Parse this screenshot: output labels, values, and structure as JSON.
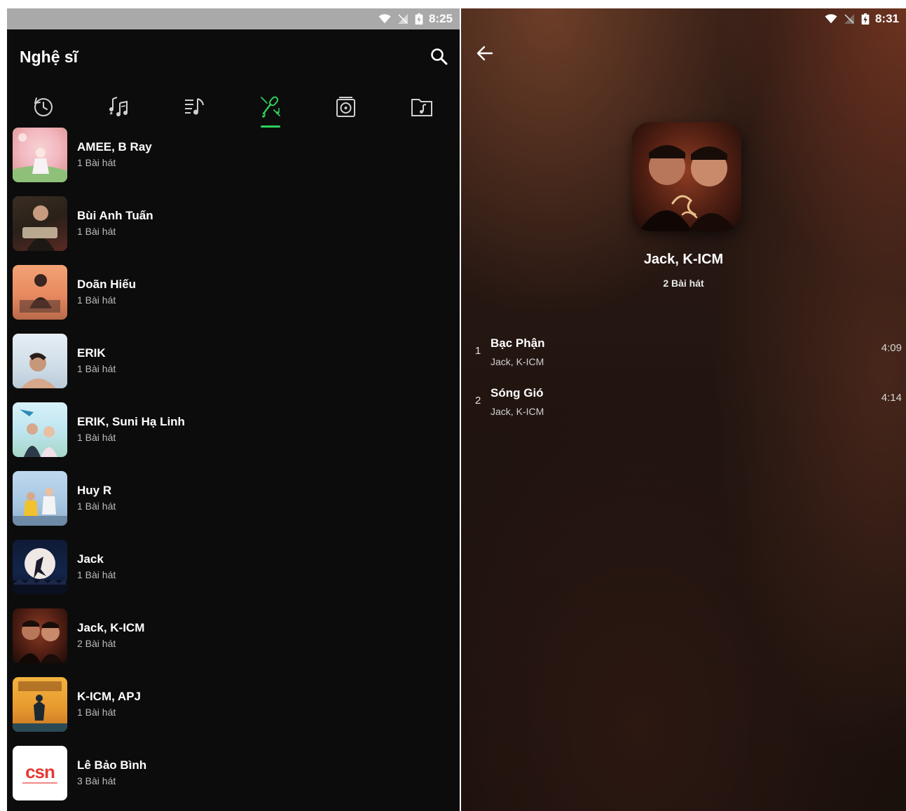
{
  "left_screen": {
    "status_bar": {
      "time": "8:25"
    },
    "header": {
      "title": "Nghệ sĩ"
    },
    "tabs": [
      {
        "icon": "history-icon"
      },
      {
        "icon": "songs-icon"
      },
      {
        "icon": "playlist-icon"
      },
      {
        "icon": "artist-mic-icon",
        "active": true
      },
      {
        "icon": "album-icon"
      },
      {
        "icon": "folder-music-icon"
      }
    ],
    "accent_color": "#2fd05a",
    "artists": [
      {
        "name": "AMEE, B Ray",
        "count": "1 Bài hát"
      },
      {
        "name": "Bùi Anh Tuấn",
        "count": "1 Bài hát"
      },
      {
        "name": "Doãn Hiếu",
        "count": "1 Bài hát"
      },
      {
        "name": "ERIK",
        "count": "1 Bài hát"
      },
      {
        "name": "ERIK, Suni Hạ Linh",
        "count": "1 Bài hát"
      },
      {
        "name": "Huy R",
        "count": "1 Bài hát"
      },
      {
        "name": "Jack",
        "count": "1 Bài hát"
      },
      {
        "name": "Jack, K-ICM",
        "count": "2 Bài hát"
      },
      {
        "name": "K-ICM, APJ",
        "count": "1 Bài hát"
      },
      {
        "name": "Lê Bảo Bình",
        "count": "3 Bài hát"
      }
    ],
    "csn_logo_text": "csn"
  },
  "right_screen": {
    "status_bar": {
      "time": "8:31"
    },
    "detail": {
      "artist": "Jack, K-ICM",
      "count": "2 Bài hát"
    },
    "tracks": [
      {
        "number": "1",
        "title": "Bạc Phận",
        "artist": "Jack, K-ICM",
        "duration": "4:09"
      },
      {
        "number": "2",
        "title": "Sóng Gió",
        "artist": "Jack, K-ICM",
        "duration": "4:14"
      }
    ]
  }
}
